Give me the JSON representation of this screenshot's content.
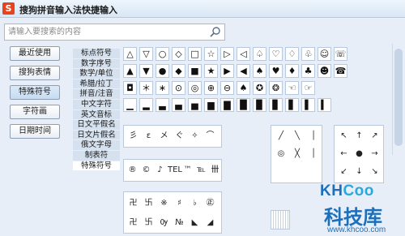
{
  "app": {
    "title": "搜狗拼音输入法快捷输入",
    "logo_letter": "S"
  },
  "search": {
    "placeholder": "请输入要搜索的内容"
  },
  "nav": {
    "items": [
      {
        "label": "最近使用"
      },
      {
        "label": "搜狗表情"
      },
      {
        "label": "特殊符号"
      },
      {
        "label": "字符画"
      },
      {
        "label": "日期时间"
      }
    ]
  },
  "categories": {
    "items": [
      {
        "label": "标点符号"
      },
      {
        "label": "数字序号"
      },
      {
        "label": "数学/单位"
      },
      {
        "label": "希腊/拉丁"
      },
      {
        "label": "拼音/注音"
      },
      {
        "label": "中文字符"
      },
      {
        "label": "英文音标"
      },
      {
        "label": "日文平假名"
      },
      {
        "label": "日文片假名"
      },
      {
        "label": "俄文字母"
      },
      {
        "label": "制表符"
      },
      {
        "label": "特殊符号"
      }
    ]
  },
  "symbols": {
    "row1": [
      "△",
      "▽",
      "○",
      "◇",
      "□",
      "☆",
      "▷",
      "◁",
      "♤",
      "♡",
      "♢",
      "♧",
      "☺",
      "☏"
    ],
    "row2": [
      "▲",
      "▼",
      "●",
      "◆",
      "■",
      "★",
      "▶",
      "◀",
      "♠",
      "♥",
      "♦",
      "♣",
      "☻",
      "☎"
    ],
    "row3": [
      "◘",
      "＊",
      "∗",
      "⊙",
      "◎",
      "⊕",
      "⊖",
      "♠",
      "✪",
      "❂",
      "☜",
      "☞"
    ],
    "row4": [
      "▁",
      "▂",
      "▃",
      "▄",
      "▅",
      "▆",
      "▇",
      "█",
      "▉",
      "▊",
      "▋",
      "▌",
      "▍"
    ]
  },
  "groups": {
    "g1": [
      "彡",
      "ε",
      "メ",
      "ぐ",
      "✧",
      "⌒"
    ],
    "g2": [
      "®",
      "©",
      "♪",
      "TEL",
      "™",
      "℡",
      "卌"
    ],
    "g3": [
      "卍",
      "卐",
      "※",
      "♯",
      "♭",
      "㊣",
      "卍",
      "卐",
      "Ѹ",
      "№",
      "◣",
      "◢"
    ],
    "g4": [
      "╱",
      "╲",
      "│",
      "◎",
      "╳",
      "│"
    ],
    "g5": [
      "↖",
      "↑",
      "↗",
      "←",
      "●",
      "→",
      "↙",
      "↓",
      "↘"
    ]
  },
  "watermark": {
    "brand_a": "KH",
    "brand_b": "Coo",
    "big": "科技库",
    "url": "www.khcoo.com"
  },
  "colors": {
    "accent": "#1d6fb9",
    "logo": "#e8431b"
  }
}
